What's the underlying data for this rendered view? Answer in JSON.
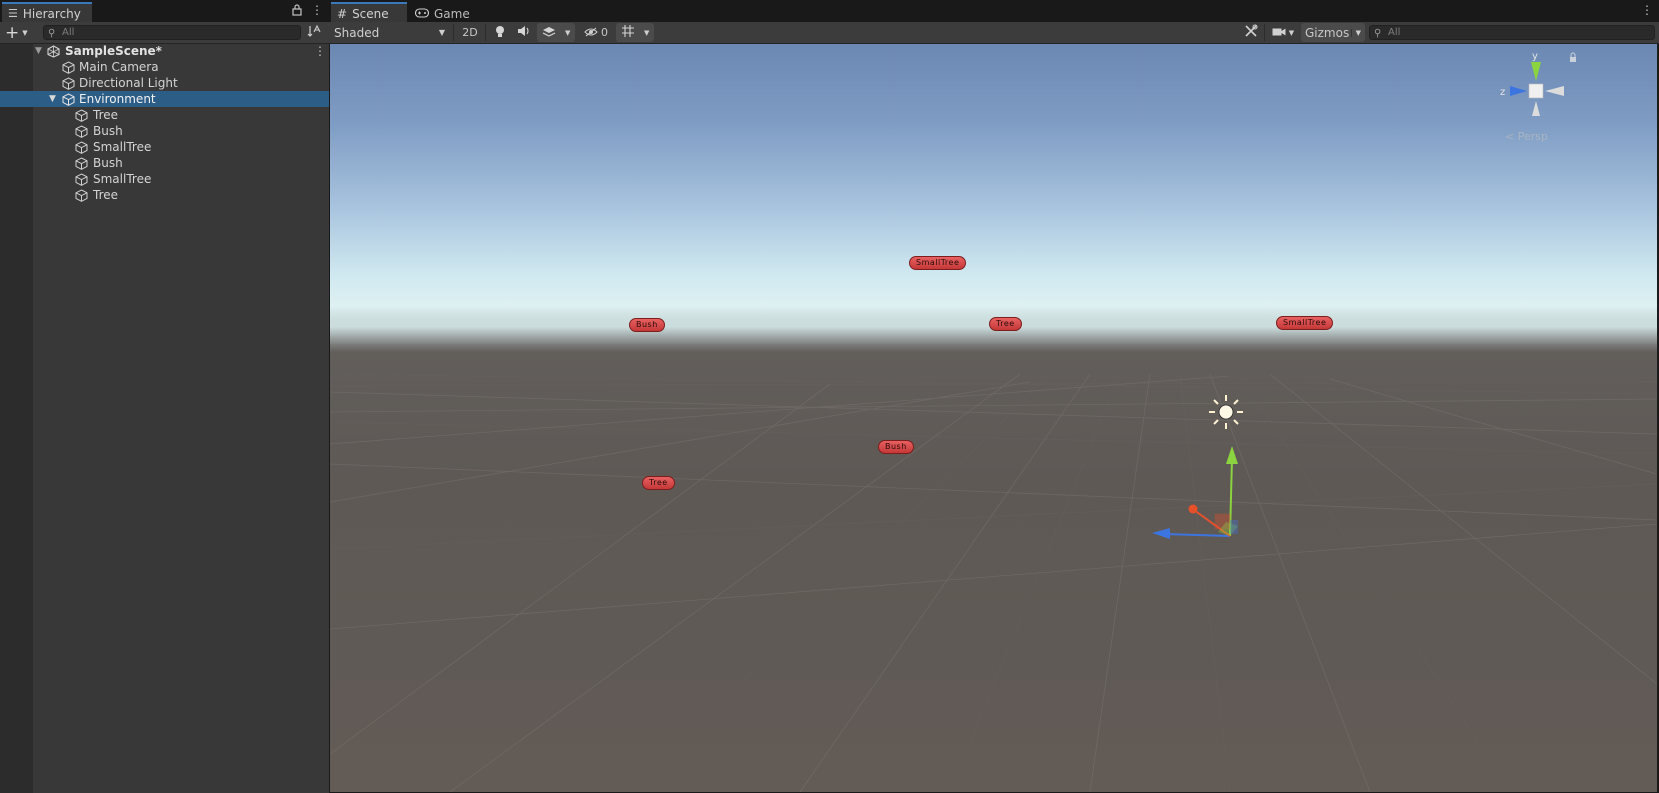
{
  "hierarchy": {
    "tab_label": "Hierarchy",
    "add_label": "+",
    "search_placeholder": "All",
    "items": [
      {
        "label": "SampleScene*",
        "kind": "scene"
      },
      {
        "label": "Main Camera",
        "kind": "object"
      },
      {
        "label": "Directional Light",
        "kind": "object"
      },
      {
        "label": "Environment",
        "kind": "object",
        "selected": true
      },
      {
        "label": "Tree",
        "kind": "object"
      },
      {
        "label": "Bush",
        "kind": "object"
      },
      {
        "label": "SmallTree",
        "kind": "object"
      },
      {
        "label": "Bush",
        "kind": "object"
      },
      {
        "label": "SmallTree",
        "kind": "object"
      },
      {
        "label": "Tree",
        "kind": "object"
      }
    ]
  },
  "scene_view": {
    "tabs": [
      {
        "label": "Scene",
        "active": true
      },
      {
        "label": "Game",
        "active": false
      }
    ],
    "toolbar": {
      "shading_mode": "Shaded",
      "mode_2d": "2D",
      "hidden_count": "0",
      "gizmos_label": "Gizmos",
      "search_placeholder": "All"
    },
    "orientation": {
      "y_label": "y",
      "z_label": "z",
      "projection_label": "< Persp"
    },
    "object_labels": [
      {
        "label": "SmallTree"
      },
      {
        "label": "Bush"
      },
      {
        "label": "Tree"
      },
      {
        "label": "SmallTree"
      },
      {
        "label": "Bush"
      },
      {
        "label": "Tree"
      }
    ]
  },
  "colors": {
    "selection": "#2c5d87",
    "tab_accent": "#3a79bb",
    "label_pill": "#d14646",
    "axis_x": "#e8502a",
    "axis_y": "#8bd43f",
    "axis_z": "#3c75e0"
  }
}
